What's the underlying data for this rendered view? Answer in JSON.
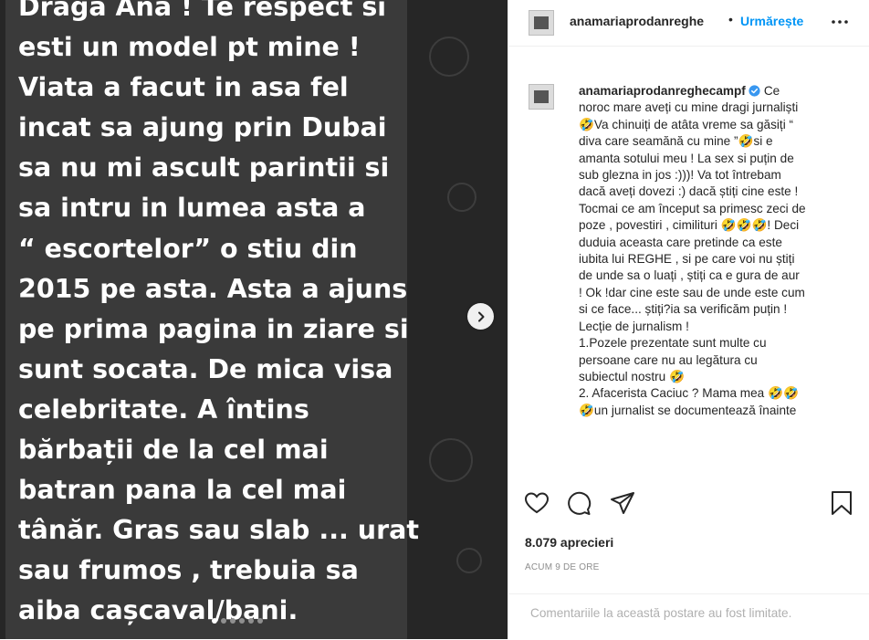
{
  "post_image": {
    "text_lines": [
      "Draga Ana ! Te respect si",
      "esti un model pt mine !",
      "Viata a facut in asa fel",
      "incat sa ajung prin Dubai",
      "sa nu mi ascult parintii si",
      "sa intru in lumea asta a",
      "“ escortelor” o stiu din",
      "2015 pe asta. Asta a ajuns",
      "pe prima pagina in ziare si",
      "sunt socata. De mica visa",
      "celebritate. A întins",
      "bărbații de la cel mai",
      "batran pana la cel mai",
      "tânăr. Gras sau slab ... urat",
      "sau frumos , trebuia sa",
      "aiba cașcaval/bani."
    ],
    "next_icon": "chevron-right-icon",
    "carousel_count": 6,
    "carousel_active": 1
  },
  "header": {
    "username": "anamariaprodanreghe",
    "separator": "•",
    "follow_label": "Urmărește",
    "more_icon": "more-horizontal-icon"
  },
  "caption": {
    "username": "anamariaprodanreghecampf",
    "verified_icon": "verified-badge-icon",
    "lines": [
      "Ce",
      "noroc mare aveți cu mine dragi jurnaliști",
      "🤣Va chinuiți de atâta vreme sa găsiți “",
      "diva care seamănă cu mine ”🤣si e",
      "amanta sotului meu ! La sex si puțin de",
      "sub glezna in jos :)))! Va tot întrebam",
      "dacă aveți dovezi :) dacă știți cine este !",
      "Tocmai ce am început sa primesc zeci de",
      "poze , povestiri , cimilituri 🤣🤣🤣! Deci",
      "duduia aceasta care pretinde ca este",
      "iubita lui REGHE , si pe care voi nu știți",
      "de unde sa o luați , știți ca e gura de aur",
      "! Ok !dar cine este sau de unde este cum",
      "si ce face... știți?ia sa verificăm puțin !",
      "Lecție de jurnalism !",
      "1.Pozele prezentate sunt multe cu",
      "persoane care nu au legătura cu",
      "subiectul nostru 🤣",
      "2. Afacerista Caciuc ? Mama mea 🤣🤣",
      "🤣un jurnalist se documentează înainte"
    ]
  },
  "actions": {
    "like_icon": "heart-icon",
    "comment_icon": "comment-icon",
    "share_icon": "share-icon",
    "save_icon": "bookmark-icon"
  },
  "likes_text": "8.079 aprecieri",
  "timestamp": "ACUM 9 DE ORE",
  "comments_limited_text": "Comentariile la această postare au fost limitate.",
  "colors": {
    "accent": "#0095f6",
    "verified": "#3897f0",
    "media_bg": "#262626",
    "card_bg": "#3a3a3a"
  }
}
